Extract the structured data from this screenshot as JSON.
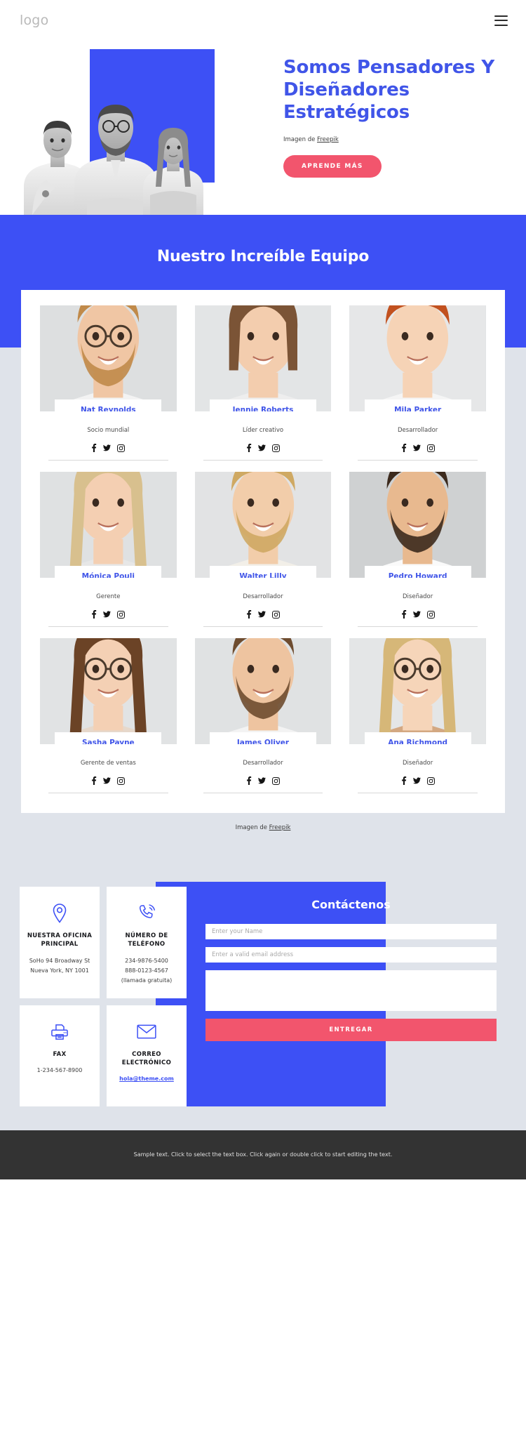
{
  "header": {
    "logo": "logo",
    "menu_icon": "hamburger-menu-icon"
  },
  "hero": {
    "title": "Somos Pensadores Y Diseñadores Estratégicos",
    "credit_prefix": "Imagen de ",
    "credit_link": "Freepik",
    "cta_label": "APRENDE MÁS",
    "accent_blue": "#3d50f5",
    "cta_color": "#f2556d"
  },
  "team": {
    "heading": "Nuestro Increíble Equipo",
    "credit_prefix": "Imagen de ",
    "credit_link": "Freepik",
    "social_icons": [
      "facebook-icon",
      "twitter-icon",
      "instagram-icon"
    ],
    "members": [
      {
        "name": "Nat Reynolds",
        "role": "Socio mundial"
      },
      {
        "name": "Jennie Roberts",
        "role": "Líder creativo"
      },
      {
        "name": "Mila Parker",
        "role": "Desarrollador"
      },
      {
        "name": "Mónica Pouli",
        "role": "Gerente"
      },
      {
        "name": "Walter Lilly",
        "role": "Desarrollador"
      },
      {
        "name": "Pedro Howard",
        "role": "Diseñador"
      },
      {
        "name": "Sasha Payne",
        "role": "Gerente de ventas"
      },
      {
        "name": "James Oliver",
        "role": "Desarrollador"
      },
      {
        "name": "Ana Richmond",
        "role": "Diseñador"
      }
    ]
  },
  "contact": {
    "cards": [
      {
        "icon": "location-pin-icon",
        "title": "NUESTRA OFICINA PRINCIPAL",
        "lines": [
          "SoHo 94 Broadway St",
          "Nueva York, NY 1001"
        ],
        "link": null
      },
      {
        "icon": "phone-icon",
        "title": "NÚMERO DE TELÉFONO",
        "lines": [
          "234-9876-5400",
          "888-0123-4567 (llamada gratuita)"
        ],
        "link": null
      },
      {
        "icon": "fax-printer-icon",
        "title": "FAX",
        "lines": [
          "1-234-567-8900"
        ],
        "link": null
      },
      {
        "icon": "envelope-icon",
        "title": "CORREO ELECTRÓNICO",
        "lines": [],
        "link": "hola@theme.com"
      }
    ],
    "form": {
      "title": "Contáctenos",
      "name_placeholder": "Enter your Name",
      "email_placeholder": "Enter a valid email address",
      "message_placeholder": "",
      "name_value": "",
      "email_value": "",
      "message_value": "",
      "submit_label": "ENTREGAR"
    }
  },
  "footer": {
    "text": "Sample text. Click to select the text box. Click again or double click to start editing the text."
  }
}
